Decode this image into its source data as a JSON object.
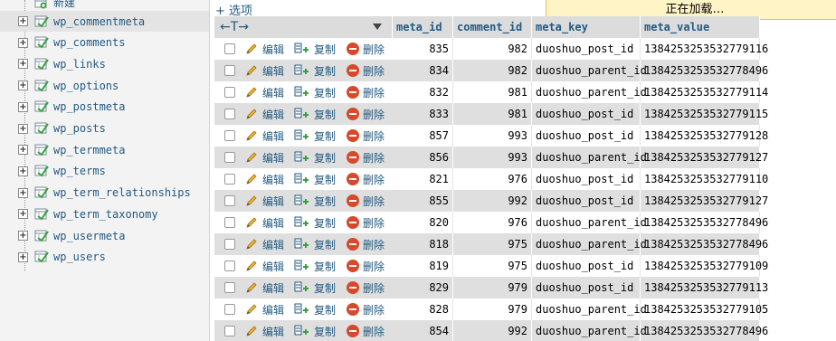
{
  "sidebar": {
    "new_label": "新建",
    "tables": [
      {
        "name": "wp_commentmeta",
        "selected": true
      },
      {
        "name": "wp_comments"
      },
      {
        "name": "wp_links"
      },
      {
        "name": "wp_options"
      },
      {
        "name": "wp_postmeta"
      },
      {
        "name": "wp_posts"
      },
      {
        "name": "wp_termmeta"
      },
      {
        "name": "wp_terms"
      },
      {
        "name": "wp_term_relationships"
      },
      {
        "name": "wp_term_taxonomy"
      },
      {
        "name": "wp_usermeta"
      },
      {
        "name": "wp_users"
      }
    ]
  },
  "toolbar": {
    "options_label": "+ 选项",
    "loading_text": "正在加载…"
  },
  "table": {
    "arrows": "←T→",
    "columns": [
      "meta_id",
      "comment_id",
      "meta_key",
      "meta_value"
    ],
    "actions": {
      "edit": "编辑",
      "copy": "复制",
      "delete": "删除"
    },
    "rows": [
      {
        "meta_id": "835",
        "comment_id": "982",
        "meta_key": "duoshuo_post_id",
        "meta_value": "1384253253532779116"
      },
      {
        "meta_id": "834",
        "comment_id": "982",
        "meta_key": "duoshuo_parent_id",
        "meta_value": "1384253253532778496"
      },
      {
        "meta_id": "832",
        "comment_id": "981",
        "meta_key": "duoshuo_parent_id",
        "meta_value": "1384253253532779114"
      },
      {
        "meta_id": "833",
        "comment_id": "981",
        "meta_key": "duoshuo_post_id",
        "meta_value": "1384253253532779115"
      },
      {
        "meta_id": "857",
        "comment_id": "993",
        "meta_key": "duoshuo_post_id",
        "meta_value": "1384253253532779128"
      },
      {
        "meta_id": "856",
        "comment_id": "993",
        "meta_key": "duoshuo_parent_id",
        "meta_value": "1384253253532779127"
      },
      {
        "meta_id": "821",
        "comment_id": "976",
        "meta_key": "duoshuo_post_id",
        "meta_value": "1384253253532779110"
      },
      {
        "meta_id": "855",
        "comment_id": "992",
        "meta_key": "duoshuo_post_id",
        "meta_value": "1384253253532779127"
      },
      {
        "meta_id": "820",
        "comment_id": "976",
        "meta_key": "duoshuo_parent_id",
        "meta_value": "1384253253532778496"
      },
      {
        "meta_id": "818",
        "comment_id": "975",
        "meta_key": "duoshuo_parent_id",
        "meta_value": "1384253253532778496"
      },
      {
        "meta_id": "819",
        "comment_id": "975",
        "meta_key": "duoshuo_post_id",
        "meta_value": "1384253253532779109"
      },
      {
        "meta_id": "829",
        "comment_id": "979",
        "meta_key": "duoshuo_post_id",
        "meta_value": "1384253253532779113"
      },
      {
        "meta_id": "828",
        "comment_id": "979",
        "meta_key": "duoshuo_parent_id",
        "meta_value": "1384253253532779105"
      },
      {
        "meta_id": "854",
        "comment_id": "992",
        "meta_key": "duoshuo_parent_id",
        "meta_value": "1384253253532778496"
      }
    ]
  }
}
